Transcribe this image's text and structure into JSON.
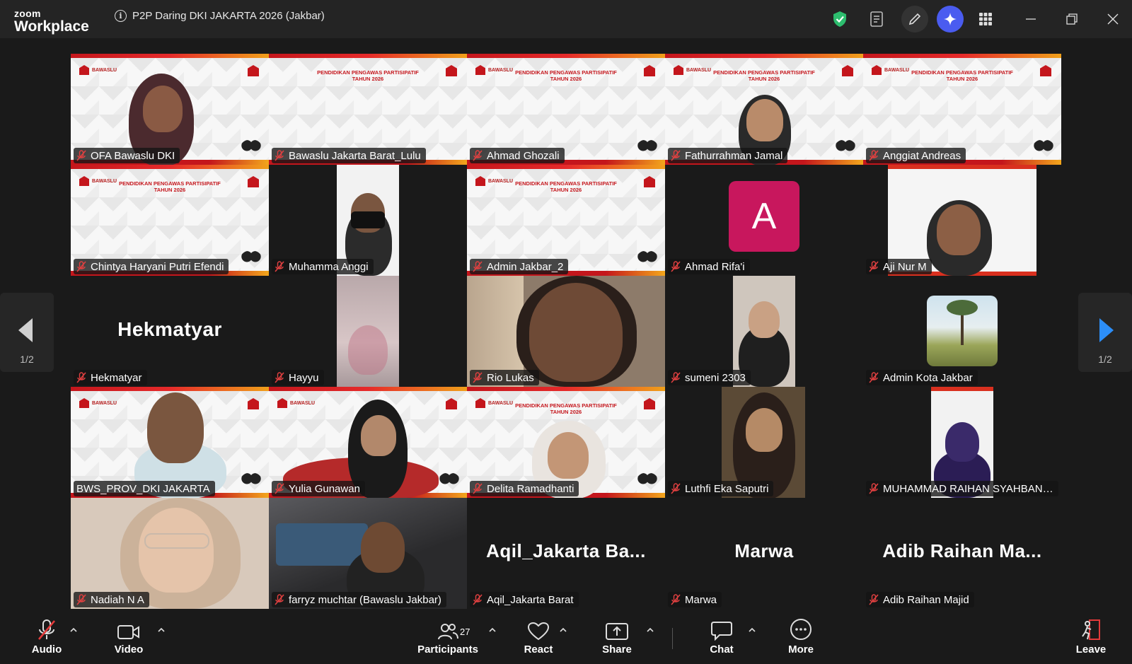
{
  "titlebar": {
    "brand_top": "zoom",
    "brand_bottom": "Workplace",
    "meeting_title": "P2P Daring DKI JAKARTA 2026 (Jakbar)",
    "info_glyph": "i",
    "icons": [
      "shield-check-icon",
      "notes-icon",
      "edit-icon",
      "ai-companion-icon",
      "apps-grid-icon",
      "minimize-icon",
      "restore-icon",
      "close-icon"
    ],
    "accent_shield": "#2dbd6e",
    "accent_ai": "#4a5cf0"
  },
  "banner": {
    "logo_text": "BAWASLU",
    "headline_1": "PENDIDIKAN PENGAWAS PARTISIPATIF",
    "headline_2": "TAHUN 2026"
  },
  "participants": [
    {
      "name": "OFA Bawaslu DKI"
    },
    {
      "name": "Bawaslu Jakarta Barat_Lulu"
    },
    {
      "name": "Ahmad Ghozali"
    },
    {
      "name": "Fathurrahman Jamal"
    },
    {
      "name": "Anggiat Andreas"
    },
    {
      "name": "Chintya Haryani Putri Efendi"
    },
    {
      "name": "Muhamma Anggi"
    },
    {
      "name": "Admin Jakbar_2"
    },
    {
      "name": "Ahmad Rifa'i",
      "avatar_letter": "A"
    },
    {
      "name": "Aji Nur M"
    },
    {
      "name": "Hekmatyar",
      "display": "Hekmatyar"
    },
    {
      "name": "Hayyu"
    },
    {
      "name": "Rio Lukas"
    },
    {
      "name": "sumeni 2303"
    },
    {
      "name": "Admin Kota Jakbar"
    },
    {
      "name": "BWS_PROV_DKI JAKARTA"
    },
    {
      "name": "Yulia Gunawan"
    },
    {
      "name": "Delita Ramadhanti"
    },
    {
      "name": "Luthfi Eka Saputri"
    },
    {
      "name": "MUHAMMAD RAIHAN SYAHBANY..."
    },
    {
      "name": "Nadiah N A"
    },
    {
      "name": "farryz muchtar (Bawaslu Jakbar)"
    },
    {
      "name": "Aqil_Jakarta Barat",
      "display": "Aqil_Jakarta  Ba..."
    },
    {
      "name": "Marwa",
      "display": "Marwa"
    },
    {
      "name": "Adib Raihan Majid",
      "display": "Adib  Raihan  Ma..."
    }
  ],
  "pager": {
    "left_label": "1/2",
    "right_label": "1/2"
  },
  "toolbar": {
    "audio": "Audio",
    "video": "Video",
    "participants": "Participants",
    "participants_count": "27",
    "react": "React",
    "share": "Share",
    "chat": "Chat",
    "more": "More",
    "leave": "Leave"
  }
}
